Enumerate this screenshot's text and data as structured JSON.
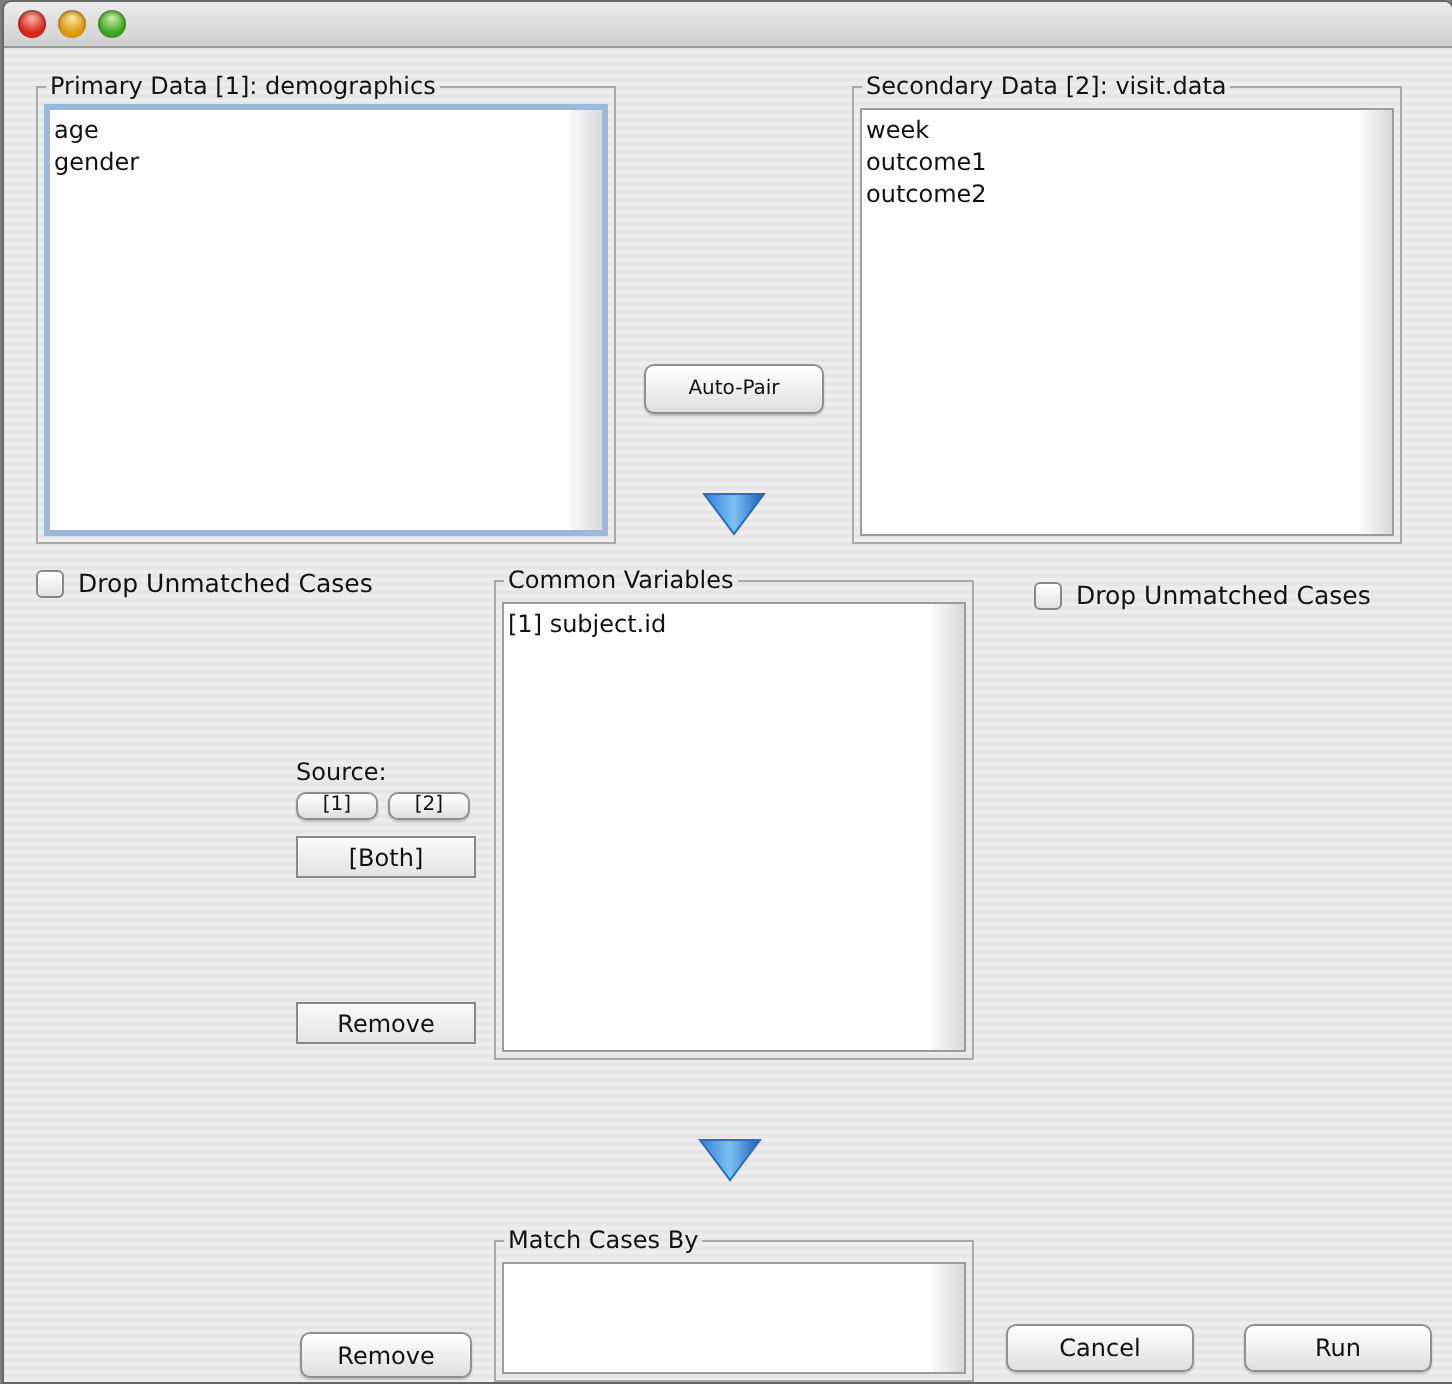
{
  "primary": {
    "title": "Primary Data [1]: demographics",
    "focused": true,
    "items": [
      "age",
      "gender"
    ]
  },
  "auto_pair": {
    "label": "Auto-Pair",
    "kind": "round"
  },
  "secondary": {
    "title": "Secondary Data [2]: visit.data",
    "focused": false,
    "items": [
      "week",
      "outcome1",
      "outcome2"
    ]
  },
  "drop_left": {
    "label": "Drop Unmatched Cases",
    "checked": false
  },
  "common": {
    "title": "Common Variables",
    "focused": false,
    "items": [
      "[1] subject.id"
    ]
  },
  "drop_right": {
    "label": "Drop Unmatched Cases",
    "checked": false
  },
  "source": {
    "label": "Source:",
    "buttons": [
      {
        "label": "[1]",
        "kind": "round"
      },
      {
        "label": "[2]",
        "kind": "round"
      },
      {
        "label": "[Both]",
        "kind": "square"
      }
    ]
  },
  "remove_common": {
    "label": "Remove",
    "kind": "square"
  },
  "match": {
    "title": "Match Cases By",
    "focused": false
  },
  "remove_match": {
    "label": "Remove",
    "kind": "round"
  },
  "actions": [
    {
      "label": "Cancel",
      "kind": "round"
    },
    {
      "label": "Run",
      "kind": "round"
    }
  ]
}
